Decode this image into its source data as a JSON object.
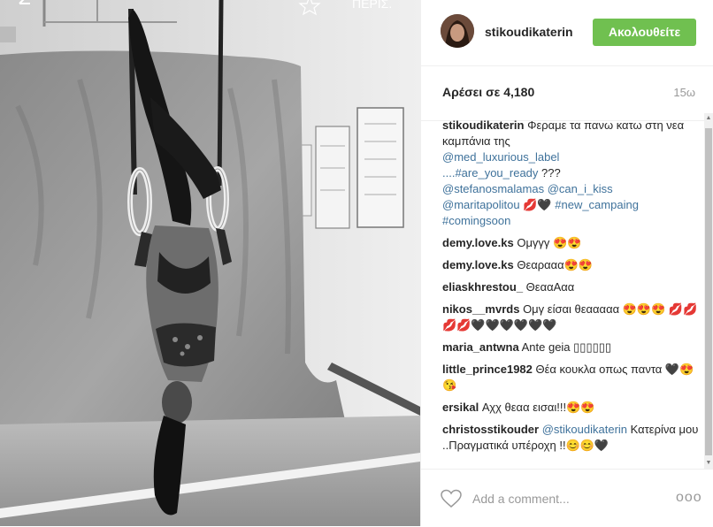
{
  "post": {
    "username": "stikoudikaterin",
    "follow_label": "Ακολουθείτε",
    "likes_text": "Αρέσει σε 4,180",
    "time": "15ω",
    "add_comment_placeholder": "Add a comment...",
    "more_label": "ooo"
  },
  "photo": {
    "overlay_text": "ΠΕΡΙΣ."
  },
  "caption": {
    "username": "stikoudikaterin",
    "text1": "Φεραμε τα πανω κατω στη νεα καμπάνια της",
    "mention1": "@med_luxurious_label",
    "dots": "....",
    "hashtag1": "#are_you_ready",
    "qmarks": " ???",
    "mention2": "@stefanosmalamas",
    "mention3": "@can_i_kiss",
    "mention4": "@maritapolitou",
    "emoji1": "💋🖤",
    "hashtag2": "#new_campaing",
    "hashtag3": "#comingsoon"
  },
  "comments": [
    {
      "user": "demy.love.ks",
      "text": "Ομγγγ 😍😍"
    },
    {
      "user": "demy.love.ks",
      "text": "Θεαρααα😍😍"
    },
    {
      "user": "eliaskhrestou_",
      "text": "ΘεααΑαα"
    },
    {
      "user": "nikos__mvrds",
      "text": "Ομγ είσαι θεααααα 😍😍😍 💋💋💋💋🖤🖤🖤🖤🖤🖤"
    },
    {
      "user": "maria_antwna",
      "text": "Ante geia ▯▯▯▯▯▯"
    },
    {
      "user": "little_prince1982",
      "text": "Θέα κουκλα οπως παντα 🖤😍😘"
    },
    {
      "user": "ersikal",
      "text": "Αχχ θεαα εισαι!!!😍😍"
    },
    {
      "user": "christosstikouder",
      "mention": "@stikoudikaterin",
      "text": "Κατερίνα μου ..Πραγματικά υπέροχη !!😊😊🖤"
    }
  ]
}
